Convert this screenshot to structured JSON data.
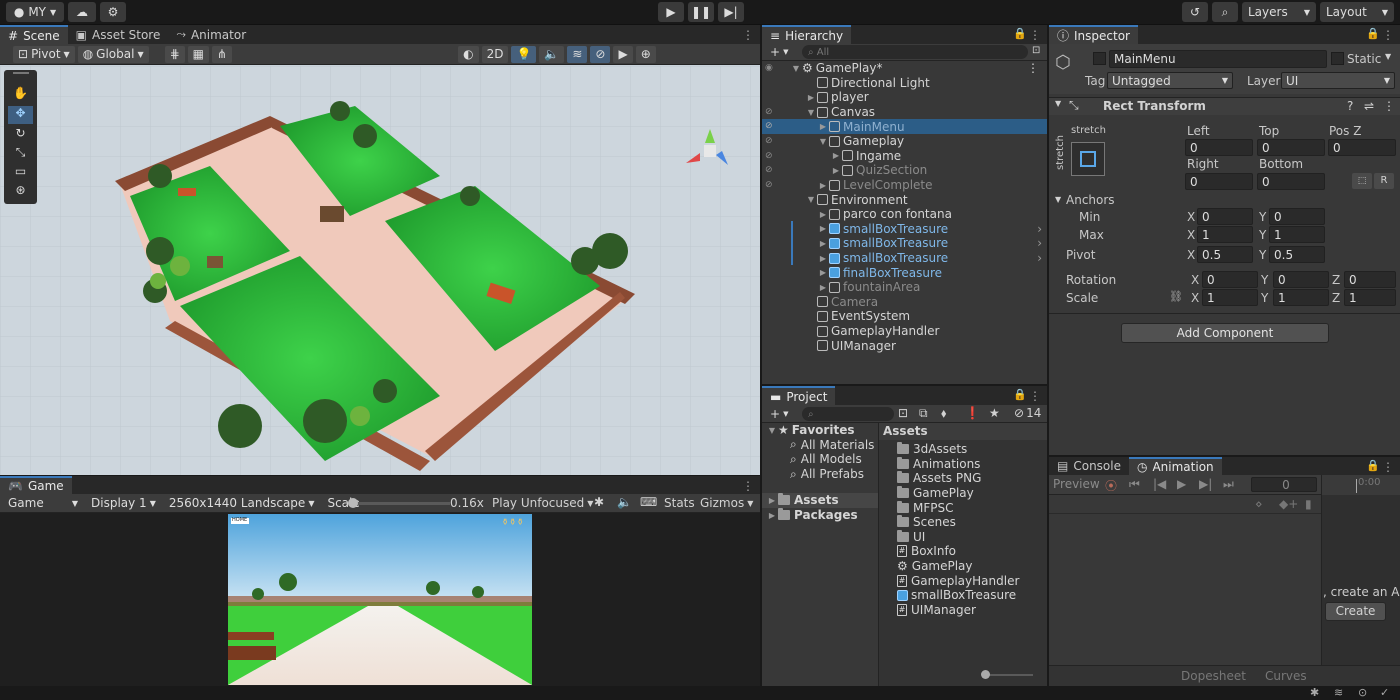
{
  "topbar": {
    "account": "MY",
    "layers": "Layers",
    "layout": "Layout"
  },
  "scene": {
    "tabs": [
      "Scene",
      "Asset Store",
      "Animator"
    ],
    "pivot": "Pivot",
    "global": "Global",
    "mode_2d": "2D"
  },
  "game": {
    "tab": "Game",
    "game_dropdown": "Game",
    "display": "Display 1",
    "resolution": "2560x1440 Landscape",
    "scale_label": "Scale",
    "scale_value": "0.16x",
    "play_mode": "Play Unfocused",
    "stats": "Stats",
    "gizmos": "Gizmos",
    "home_badge": "HOME"
  },
  "hierarchy": {
    "tab": "Hierarchy",
    "search_placeholder": "All",
    "items": [
      {
        "label": "GamePlay*",
        "indent": 0
      },
      {
        "label": "Directional Light",
        "indent": 1
      },
      {
        "label": "player",
        "indent": 1
      },
      {
        "label": "Canvas",
        "indent": 1
      },
      {
        "label": "MainMenu",
        "indent": 2
      },
      {
        "label": "Gameplay",
        "indent": 2
      },
      {
        "label": "Ingame",
        "indent": 3
      },
      {
        "label": "QuizSection",
        "indent": 3
      },
      {
        "label": "LevelComplete",
        "indent": 2
      },
      {
        "label": "Environment",
        "indent": 1
      },
      {
        "label": "parco con fontana",
        "indent": 2
      },
      {
        "label": "smallBoxTreasure",
        "indent": 2
      },
      {
        "label": "smallBoxTreasure",
        "indent": 2
      },
      {
        "label": "smallBoxTreasure",
        "indent": 2
      },
      {
        "label": "finalBoxTreasure",
        "indent": 2
      },
      {
        "label": "fountainArea",
        "indent": 2
      },
      {
        "label": "Camera",
        "indent": 1
      },
      {
        "label": "EventSystem",
        "indent": 1
      },
      {
        "label": "GameplayHandler",
        "indent": 1
      },
      {
        "label": "UIManager",
        "indent": 1
      }
    ]
  },
  "inspector": {
    "tab": "Inspector",
    "object_name": "MainMenu",
    "static_label": "Static",
    "tag_label": "Tag",
    "tag_value": "Untagged",
    "layer_label": "Layer",
    "layer_value": "UI",
    "component": "Rect Transform",
    "stretch_h": "stretch",
    "stretch_v": "stretch",
    "left_label": "Left",
    "top_label": "Top",
    "posz_label": "Pos Z",
    "right_label": "Right",
    "bottom_label": "Bottom",
    "left": "0",
    "top": "0",
    "posz": "0",
    "right": "0",
    "bottom": "0",
    "r_button": "R",
    "anchors_label": "Anchors",
    "min_label": "Min",
    "max_label": "Max",
    "pivot_label": "Pivot",
    "rotation_label": "Rotation",
    "scale_label": "Scale",
    "min_x": "0",
    "min_y": "0",
    "max_x": "1",
    "max_y": "1",
    "pivot_x": "0.5",
    "pivot_y": "0.5",
    "rot_x": "0",
    "rot_y": "0",
    "rot_z": "0",
    "scale_x": "1",
    "scale_y": "1",
    "scale_z": "1",
    "x": "X",
    "y": "Y",
    "z": "Z",
    "add_component": "Add Component"
  },
  "project": {
    "tab": "Project",
    "hidden_count": "14",
    "favorites": "Favorites",
    "fav_items": [
      "All Materials",
      "All Models",
      "All Prefabs"
    ],
    "assets_root": "Assets",
    "packages": "Packages",
    "assets_header": "Assets",
    "assets": [
      {
        "label": "3dAssets",
        "kind": "folder"
      },
      {
        "label": "Animations",
        "kind": "folder"
      },
      {
        "label": "Assets PNG",
        "kind": "folder"
      },
      {
        "label": "GamePlay",
        "kind": "folder"
      },
      {
        "label": "MFPSC",
        "kind": "folder"
      },
      {
        "label": "Scenes",
        "kind": "folder"
      },
      {
        "label": "UI",
        "kind": "folder"
      },
      {
        "label": "BoxInfo",
        "kind": "script"
      },
      {
        "label": "GamePlay",
        "kind": "scene"
      },
      {
        "label": "GameplayHandler",
        "kind": "script"
      },
      {
        "label": "smallBoxTreasure",
        "kind": "prefab"
      },
      {
        "label": "UIManager",
        "kind": "script"
      }
    ]
  },
  "animation": {
    "tabs": [
      "Console",
      "Animation"
    ],
    "preview": "Preview",
    "frame": "0",
    "time": "0:00",
    "hint": ", create an A",
    "create": "Create",
    "dopesheet": "Dopesheet",
    "curves": "Curves"
  },
  "colors": {
    "accent": "#3a79bb",
    "selection": "#2c5d87",
    "panel": "#383838",
    "grass": "#2fbf3a"
  }
}
